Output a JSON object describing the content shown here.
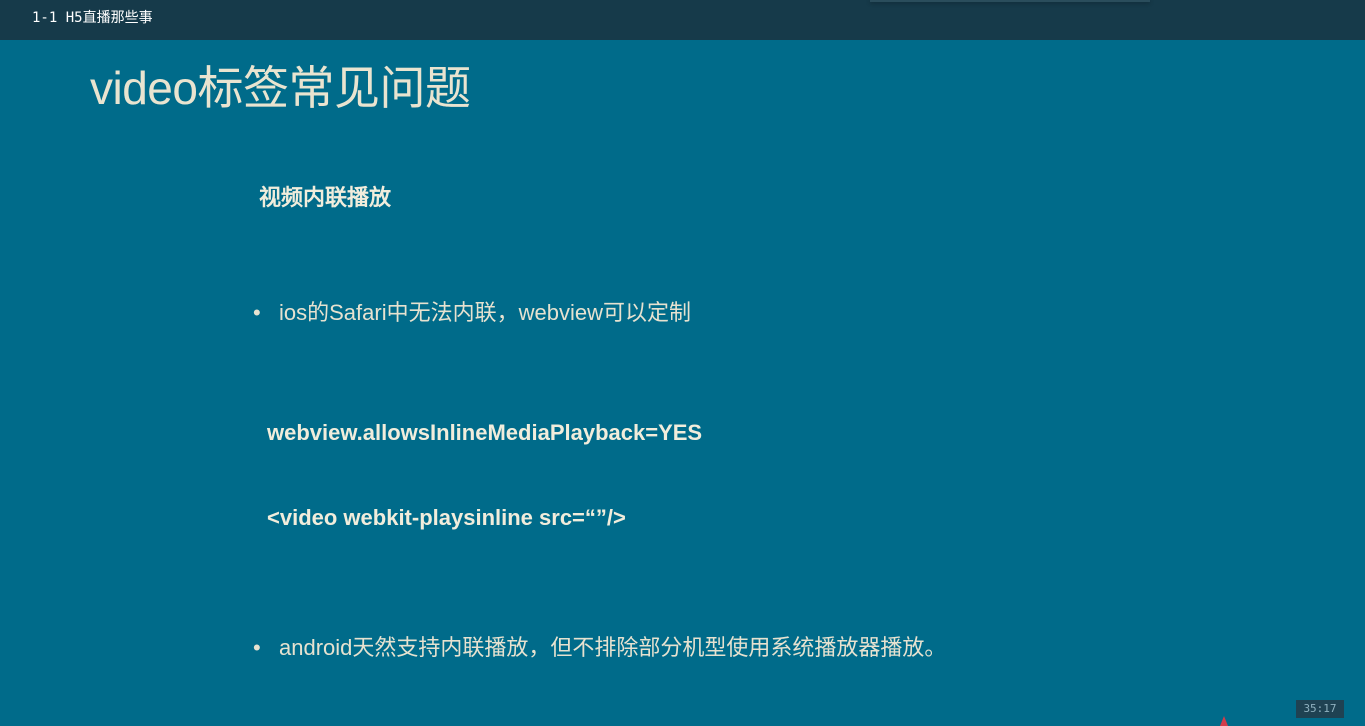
{
  "window": {
    "title": "1-1 H5直播那些事"
  },
  "slide": {
    "title": "video标签常见问题",
    "section_heading": "视频内联播放",
    "bullet_symbol": "•",
    "bullets": [
      {
        "text": "ios的Safari中无法内联，webview可以定制"
      },
      {
        "text": "android天然支持内联播放，但不排除部分机型使用系统播放器播放。"
      }
    ],
    "code_lines": [
      "webview.allowsInlineMediaPlayback=YES",
      "<video webkit-playsinline  src=“”/>"
    ]
  },
  "player": {
    "timestamp": "35:17"
  },
  "colors": {
    "slide_background": "#006b8a",
    "topbar_background": "#163a4a",
    "text": "#e9e4d0"
  }
}
